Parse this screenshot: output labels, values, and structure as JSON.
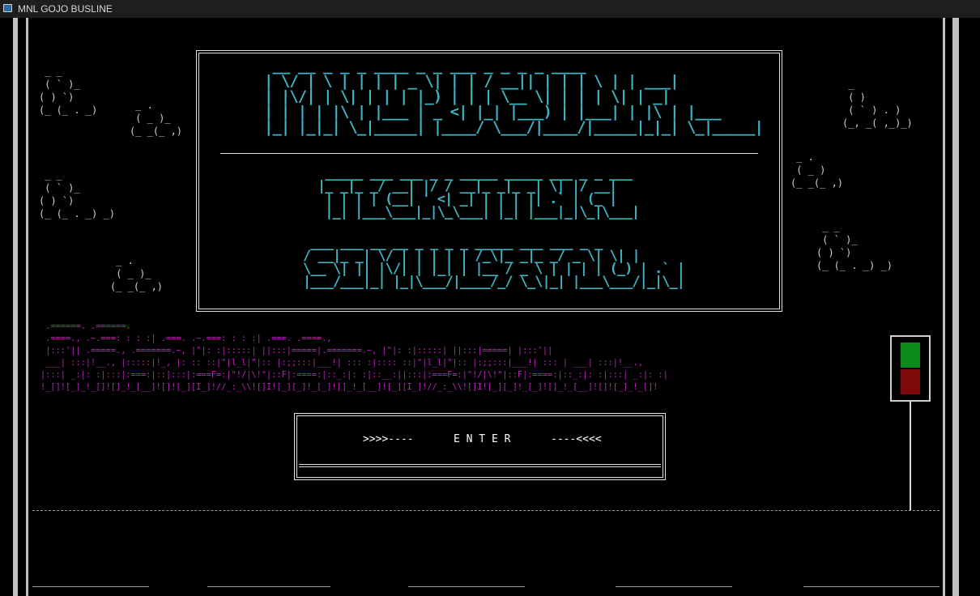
{
  "window": {
    "title": "MNL GOJO BUSLINE"
  },
  "clouds": {
    "c1": " _ _\n ( ` )_\n( ) `)\n(_ (_ . _)",
    "c2": " _ .\n ( _ )_\n(_ _(_ ,)",
    "c3": " _ _\n ( ` )_\n( ) `)\n(_ (_ . _) _)",
    "c4": " _ .\n ( _ )_\n(_ _(_ ,)",
    "c5": " _\n ( )\n ( ` ) . )\n(_, _( ,_)_)",
    "c6": " _ .\n ( _ )\n(_ _(_ ,)",
    "c7": " _ _\n ( ` )_\n( ) `)\n(_ (_ . _) _)"
  },
  "banner": {
    "title_art": " __ __ _ _ _ ____ _ _ ___ _ _ _ _ ____\n| \\/ | \\ | | | | _ \\| | | / __|| | | | \\ | | ___|\n| |\\/| | \\| | | | |_) | | | \\__ \\| | | | \\| | _|\n| | | | |\\ | |___ | _ <| |_| |___) | |___| | |\\ | |___\n|_| |_|_| \\_|_____| |____/ \\___/|____/|_____|_|_| \\_|_____|",
    "ticketing_art": " _____ ___ ___ _ _ _____ _____ ___ _ _ ___\n|_ _|_ _/ __| |/ / __|_ _|_ _| \\| |/ __|\n | | | | (__| ' <| _| | | | || .` | (_ |\n |_| |___\\___|_|\\_\\___| |_| |___|_|\\_|\\___|",
    "simulation_art": " ___ ___ __ __ _ _ _ _ _____ ___ ___ _ _\n/ __|_ _| \\/ | | | | | /_\\|_ _|_ _/ _ \\| \\| |\n\\__ \\| || |\\/| | |_| | |__ / _ \\ | | | | (_) | .` |\n|___/___|_| |_|\\___/|____/_/ \\_\\|_| |___\\___/|_|\\_|"
  },
  "city_art": " .======. .======.\n .====., .~.===: : : :| .===. .~.===: : : :| .===. .====.,\n |:::'|| .=====., .=======.~, |\"|: :|:::::| ||:::|=====|.=======.~, |\"|: :|:::::| ||:::|=====| |:::'||\n ___| :::|!__., |:::::|!_, |: :: ::|\"|l_l|\"|:: |:;;:::|___!| ::: :|:::: ::|\"|l_l|\"|:: |:;;:::|___!| ::: | ___| :::|!__.,\n|:::| _:|: :|:::|:===:|::|:::|:===F=:|\"!/|\\!\"|::F|:====:|::_:|: :|::__:||:::|:===F=:|\"!/|\\!\"|::F|:====:|::_:|: :|:::| _:|: :|\n!_[]![_]_!_[]![]_!_[__]![]![_][I_]!//_:_\\\\![]I![_][_]!_[_]![]_!_[__]![_][I_]!//_:_\\\\![]I![_][_]!_[_]![]_!_[__]![]![_]_!_[]!",
  "enter": {
    "left": ">>>>----",
    "label": "E N T E R",
    "right": "----<<<<"
  },
  "colors": {
    "background": "#000000",
    "title_text": "#3fb5c4",
    "city": "#b428b4",
    "traffic_light_green": "#0a8a1a",
    "traffic_light_red": "#7d0a0a",
    "frame": "#e0e0e0"
  }
}
